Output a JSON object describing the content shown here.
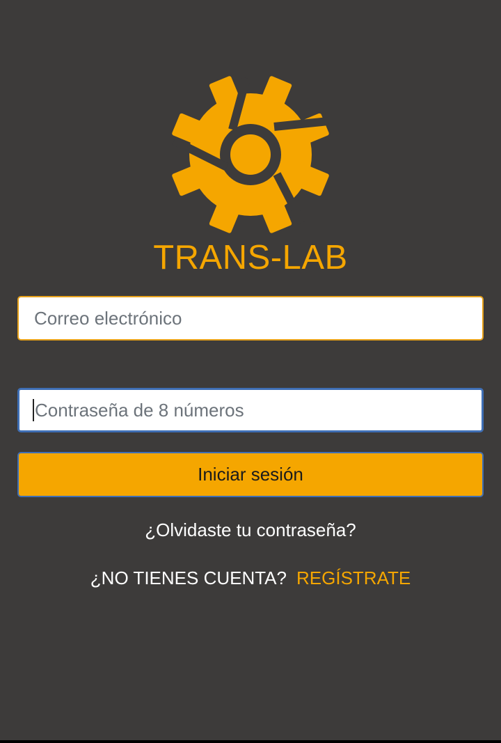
{
  "app": {
    "brand_name": "TRANS-LAB",
    "accent_color": "#f5a600",
    "background_color": "#3d3b3a",
    "logo_icon": "gear-logo-icon"
  },
  "login_form": {
    "email": {
      "placeholder": "Correo electrónico",
      "value": ""
    },
    "password": {
      "placeholder": "Contraseña de 8 números",
      "value": ""
    },
    "submit_label": "Iniciar sesión"
  },
  "links": {
    "forgot_password": "¿Olvidaste tu contraseña?",
    "no_account": "¿NO TIENES CUENTA?",
    "register": "REGÍSTRATE"
  }
}
